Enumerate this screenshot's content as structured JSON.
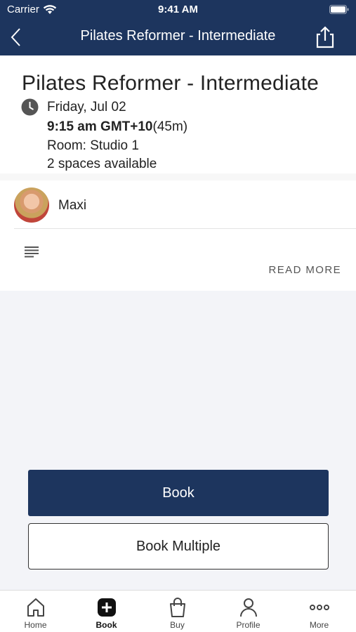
{
  "status_bar": {
    "carrier": "Carrier",
    "time": "9:41 AM"
  },
  "nav": {
    "title": "Pilates Reformer - Intermediate",
    "back_icon": "chevron-left-icon",
    "share_icon": "share-icon"
  },
  "class_detail": {
    "title": "Pilates Reformer - Intermediate",
    "date": "Friday, Jul 02",
    "time": "9:15 am GMT+10",
    "duration": "(45m)",
    "room": "Room: Studio 1",
    "spaces": "2 spaces available"
  },
  "instructor": {
    "name": "Maxi"
  },
  "description": {
    "icon": "text-lines-icon",
    "read_more_label": "READ MORE"
  },
  "actions": {
    "book_label": "Book",
    "book_multiple_label": "Book Multiple"
  },
  "tabs": [
    {
      "label": "Home",
      "icon": "home-icon",
      "active": false
    },
    {
      "label": "Book",
      "icon": "plus-square-icon",
      "active": true
    },
    {
      "label": "Buy",
      "icon": "shopping-bag-icon",
      "active": false
    },
    {
      "label": "Profile",
      "icon": "person-icon",
      "active": false
    },
    {
      "label": "More",
      "icon": "more-dots-icon",
      "active": false
    }
  ],
  "colors": {
    "brand_navy": "#1d355e",
    "background": "#f3f4f8"
  }
}
